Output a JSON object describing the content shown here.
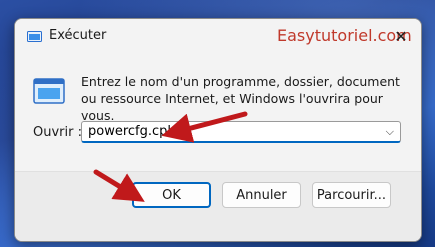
{
  "window": {
    "title": "Exécuter",
    "watermark": "Easytutoriel.com",
    "close_icon": "close-icon"
  },
  "description": "Entrez le nom d'un programme, dossier, document ou ressource Internet, et Windows l'ouvrira pour vous.",
  "open_field": {
    "label": "Ouvrir :",
    "value": "powercfg.cpl"
  },
  "buttons": {
    "ok": "OK",
    "cancel": "Annuler",
    "browse": "Parcourir..."
  },
  "colors": {
    "accent": "#0067c0",
    "annotation_arrow": "#c0191b",
    "watermark": "#c0392b"
  }
}
